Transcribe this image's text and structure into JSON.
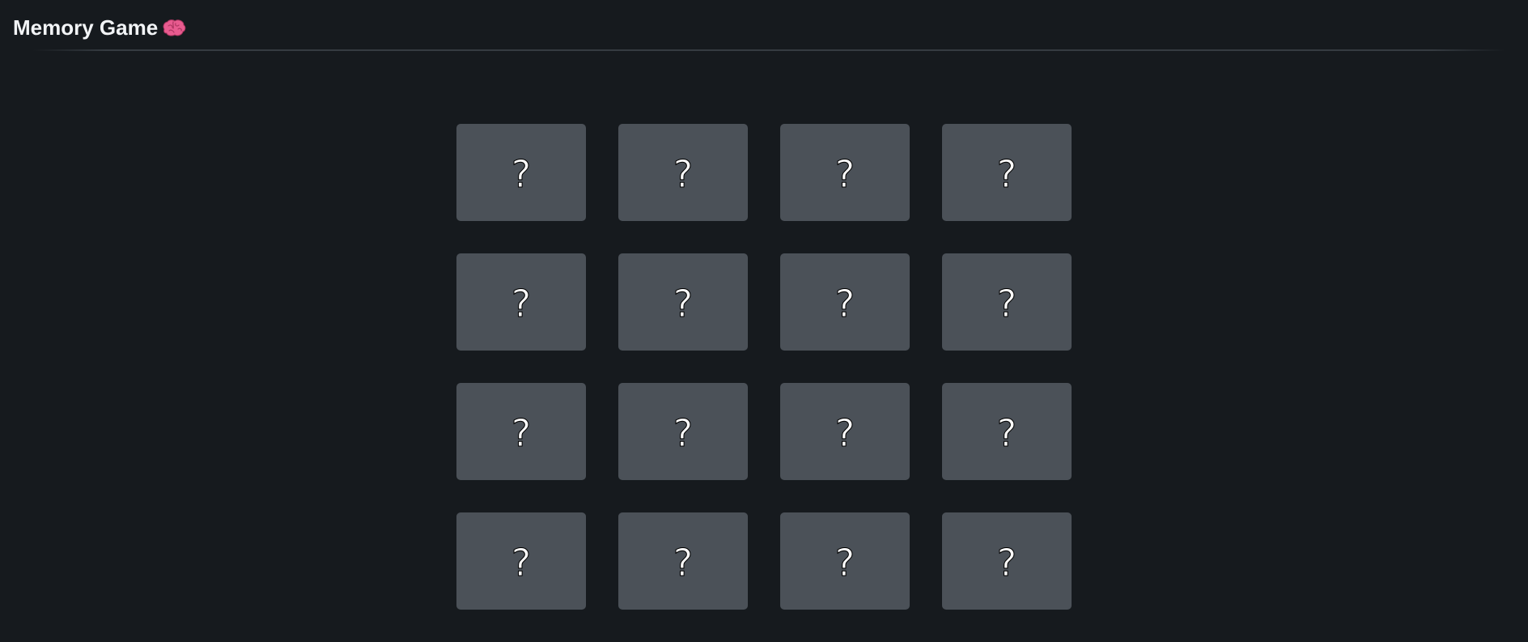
{
  "header": {
    "title": "Memory Game",
    "title_icon": "brain-icon"
  },
  "board": {
    "rows": 4,
    "columns": 4,
    "cards": [
      {
        "symbol": "?",
        "state": "face-down"
      },
      {
        "symbol": "?",
        "state": "face-down"
      },
      {
        "symbol": "?",
        "state": "face-down"
      },
      {
        "symbol": "?",
        "state": "face-down"
      },
      {
        "symbol": "?",
        "state": "face-down"
      },
      {
        "symbol": "?",
        "state": "face-down"
      },
      {
        "symbol": "?",
        "state": "face-down"
      },
      {
        "symbol": "?",
        "state": "face-down"
      },
      {
        "symbol": "?",
        "state": "face-down"
      },
      {
        "symbol": "?",
        "state": "face-down"
      },
      {
        "symbol": "?",
        "state": "face-down"
      },
      {
        "symbol": "?",
        "state": "face-down"
      },
      {
        "symbol": "?",
        "state": "face-down"
      },
      {
        "symbol": "?",
        "state": "face-down"
      },
      {
        "symbol": "?",
        "state": "face-down"
      },
      {
        "symbol": "?",
        "state": "face-down"
      }
    ]
  },
  "colors": {
    "background": "#161a1e",
    "card": "#4b5158",
    "title": "#f2f4f6",
    "brain": "#e85b8f"
  }
}
